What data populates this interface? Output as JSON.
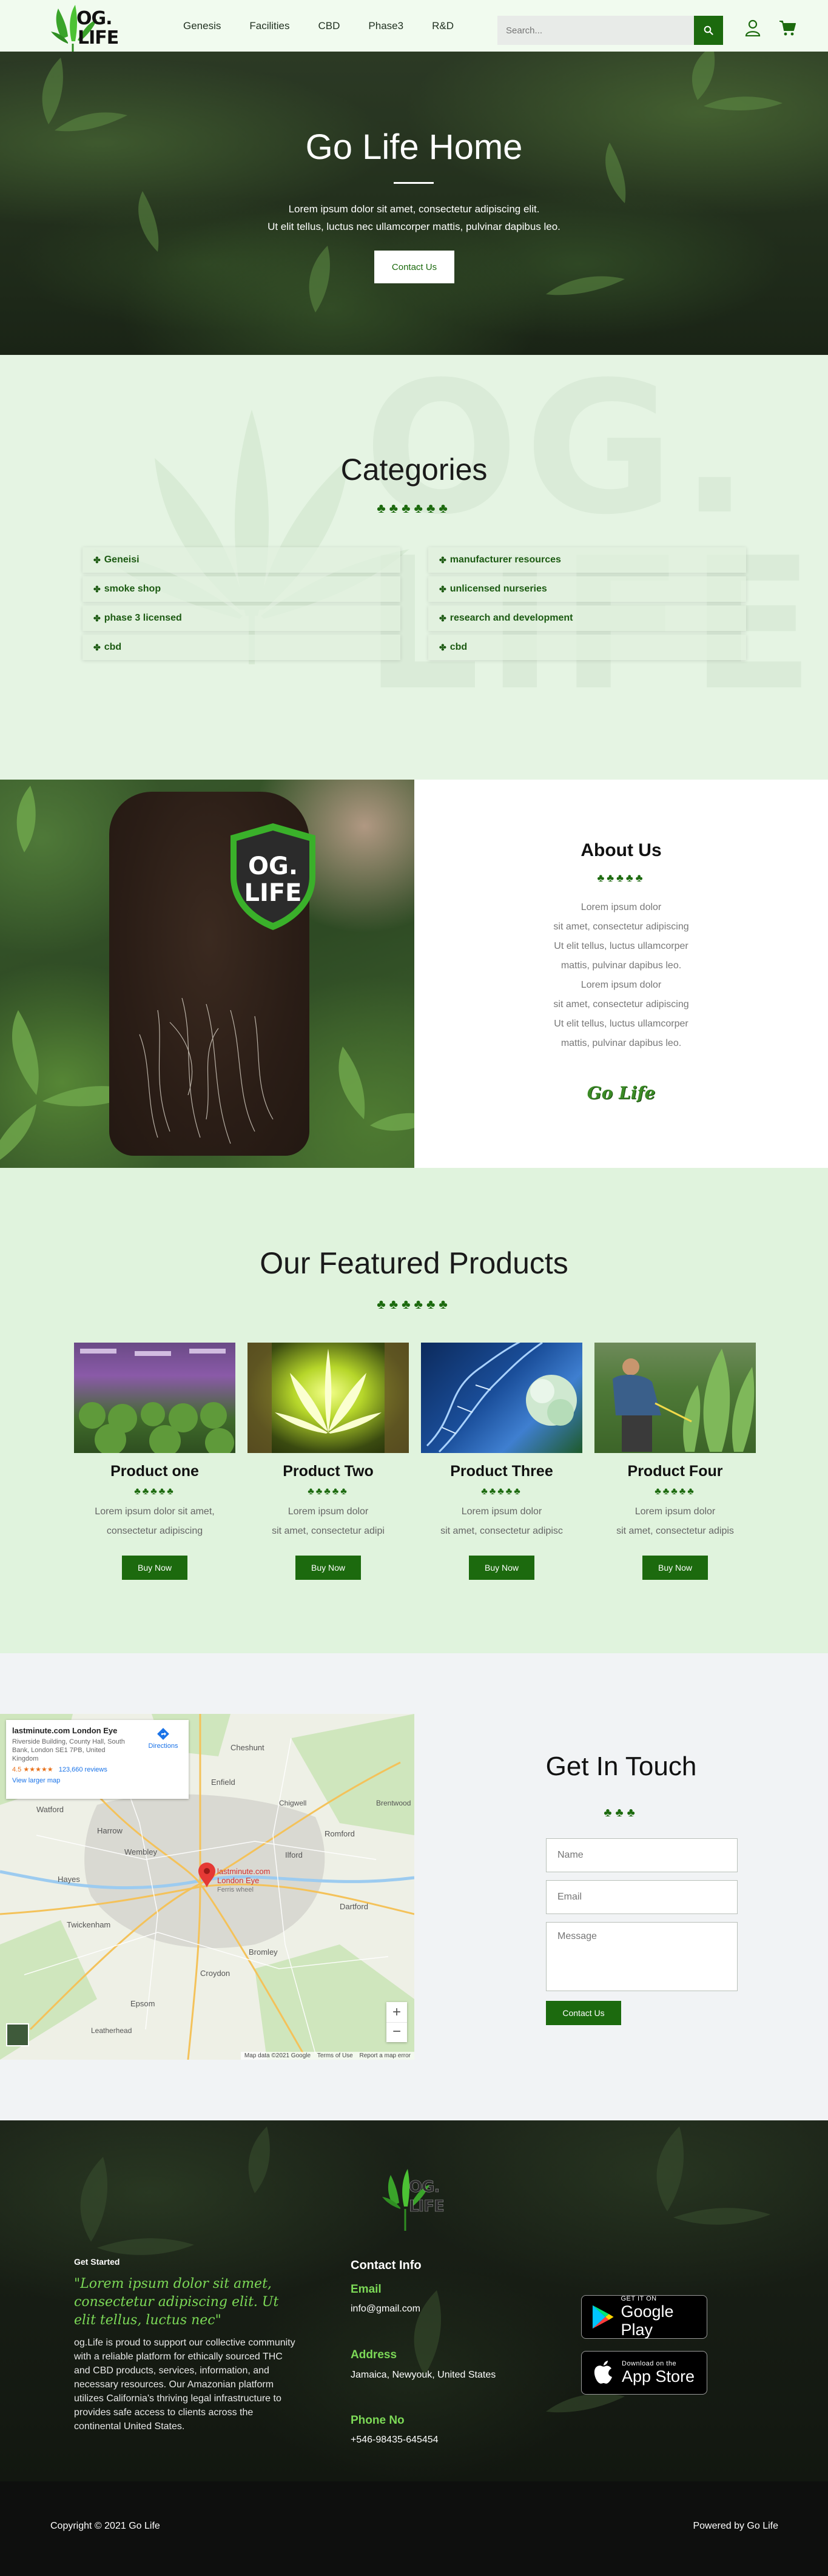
{
  "header": {
    "logo_text": "OG LIFE",
    "nav": [
      {
        "label": "Genesis"
      },
      {
        "label": "Facilities"
      },
      {
        "label": "CBD"
      },
      {
        "label": "Phase3"
      },
      {
        "label": "R&D"
      }
    ],
    "search_placeholder": "Search..."
  },
  "hero": {
    "title": "Go Life Home",
    "text_line1": "Lorem ipsum dolor sit amet, consectetur adipiscing elit.",
    "text_line2": "Ut elit tellus, luctus nec ullamcorper mattis, pulvinar dapibus leo.",
    "button": "Contact Us"
  },
  "categories": {
    "title": "Categories",
    "trees": "♣♣♣♣♣♣",
    "left": [
      "Geneisi",
      "smoke shop",
      "phase 3 licensed",
      "cbd"
    ],
    "right": [
      "manufacturer resources",
      "unlicensed nurseries",
      "research and development",
      "cbd"
    ]
  },
  "about": {
    "logo_text_top": "OG.",
    "logo_text_bottom": "LIFE",
    "title": "About Us",
    "trees": "♣♣♣♣♣",
    "paragraph1": [
      "Lorem ipsum dolor",
      "sit amet, consectetur adipiscing",
      "Ut elit tellus, luctus  ullamcorper",
      "mattis, pulvinar dapibus leo."
    ],
    "paragraph2": [
      "Lorem ipsum dolor",
      "sit amet, consectetur adipiscing",
      "Ut elit tellus, luctus  ullamcorper",
      "mattis, pulvinar dapibus leo."
    ],
    "signature": "Go Life"
  },
  "products": {
    "title": "Our Featured Products",
    "trees": "♣♣♣♣♣♣",
    "items": [
      {
        "name": "Product one",
        "trees": "♣♣♣♣♣",
        "desc_line1": "Lorem ipsum dolor sit amet,",
        "desc_line2": "consectetur adipiscing",
        "button": "Buy Now"
      },
      {
        "name": "Product Two",
        "trees": "♣♣♣♣♣",
        "desc_line1": "Lorem ipsum dolor",
        "desc_line2": "sit amet, consectetur adipi",
        "button": "Buy Now"
      },
      {
        "name": "Product Three",
        "trees": "♣♣♣♣♣",
        "desc_line1": "Lorem ipsum dolor",
        "desc_line2": "sit amet, consectetur adipisc",
        "button": "Buy Now"
      },
      {
        "name": "Product Four",
        "trees": "♣♣♣♣♣",
        "desc_line1": "Lorem ipsum dolor",
        "desc_line2": "sit amet, consectetur adipis",
        "button": "Buy Now"
      }
    ]
  },
  "map": {
    "place_name": "lastminute.com London Eye",
    "address": "Riverside Building, County Hall, South Bank, London SE1 7PB, United Kingdom",
    "rating": "4.5",
    "stars": "★★★★★",
    "reviews": "123,660 reviews",
    "view_larger": "View larger map",
    "directions": "Directions",
    "marker_label": "lastminute.com London Eye",
    "marker_sub": "Ferris wheel",
    "labels": [
      "Enfield",
      "Cheshunt",
      "Chigwell",
      "Romford",
      "Harrow",
      "Wembley",
      "Hayes",
      "Twickenham",
      "Ilford",
      "Bromley",
      "Croydon",
      "Dartford",
      "Epsom",
      "Leatherhead",
      "Watford",
      "Brentwood"
    ],
    "attribution": "Map data ©2021 Google",
    "terms": "Terms of Use",
    "report": "Report a map error",
    "zoom_in": "+",
    "zoom_out": "−"
  },
  "contact": {
    "title": "Get In Touch",
    "trees": "♣♣♣",
    "name_placeholder": "Name",
    "email_placeholder": "Email",
    "message_placeholder": "Message",
    "button": "Contact Us"
  },
  "footer": {
    "logo_text": "OG LIFE",
    "started_label": "Get Started",
    "quote": "\"Lorem ipsum dolor sit amet, consectetur adipiscing elit. Ut elit tellus, luctus nec\"",
    "about": "og.Life is proud to support our collective community with a reliable platform for ethically sourced THC and CBD products, services, information, and necessary resources. Our Amazonian platform utilizes California's thriving legal infrastructure to provides safe access to clients across the continental United States.",
    "contact_title": "Contact Info",
    "email_label": "Email",
    "email_value": "info@gmail.com",
    "address_label": "Address",
    "address_value": "Jamaica, Newyouk, United States",
    "phone_label": "Phone No",
    "phone_value": "+546-98435-645454",
    "google_small": "GET IT ON",
    "google_big": "Google Play",
    "apple_small": "Download on the",
    "apple_big": "App Store"
  },
  "bottom": {
    "copyright": "Copyright © 2021 Go Life",
    "powered": "Powered by Go Life"
  },
  "colors": {
    "accent": "#1c6a0e",
    "light_green": "#e0f3dd",
    "footer_green": "#7cd957"
  }
}
